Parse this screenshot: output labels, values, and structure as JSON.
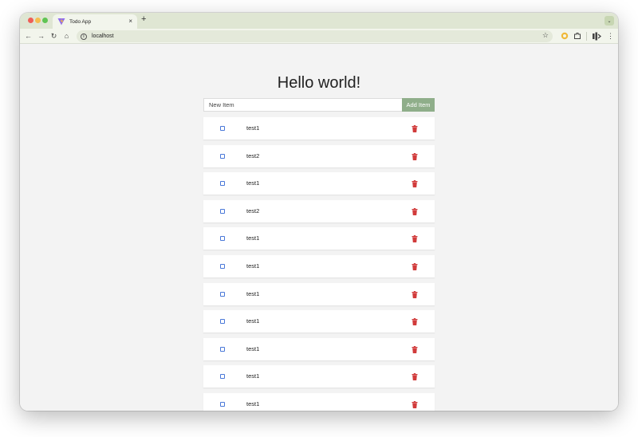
{
  "browser": {
    "tab_title": "Todo App",
    "tab_close": "×",
    "new_tab": "+",
    "url": "localhost",
    "back_icon": "←",
    "forward_icon": "→",
    "reload_icon": "↻",
    "home_icon": "⌂",
    "info_icon": "i",
    "star_icon": "☆",
    "menu_icon": "⋮",
    "tab_menu_icon": "⌄"
  },
  "app": {
    "heading": "Hello world!",
    "input_placeholder": "New Item",
    "add_label": "Add Item"
  },
  "todos": [
    {
      "text": "test1"
    },
    {
      "text": "test2"
    },
    {
      "text": "test1"
    },
    {
      "text": "test2"
    },
    {
      "text": "test1"
    },
    {
      "text": "test1"
    },
    {
      "text": "test1"
    },
    {
      "text": "test1"
    },
    {
      "text": "test1"
    },
    {
      "text": "test1"
    },
    {
      "text": "test1"
    }
  ],
  "colors": {
    "accent": "#8fae8a",
    "checkbox": "#4a78d8",
    "delete": "#d13b3b"
  }
}
